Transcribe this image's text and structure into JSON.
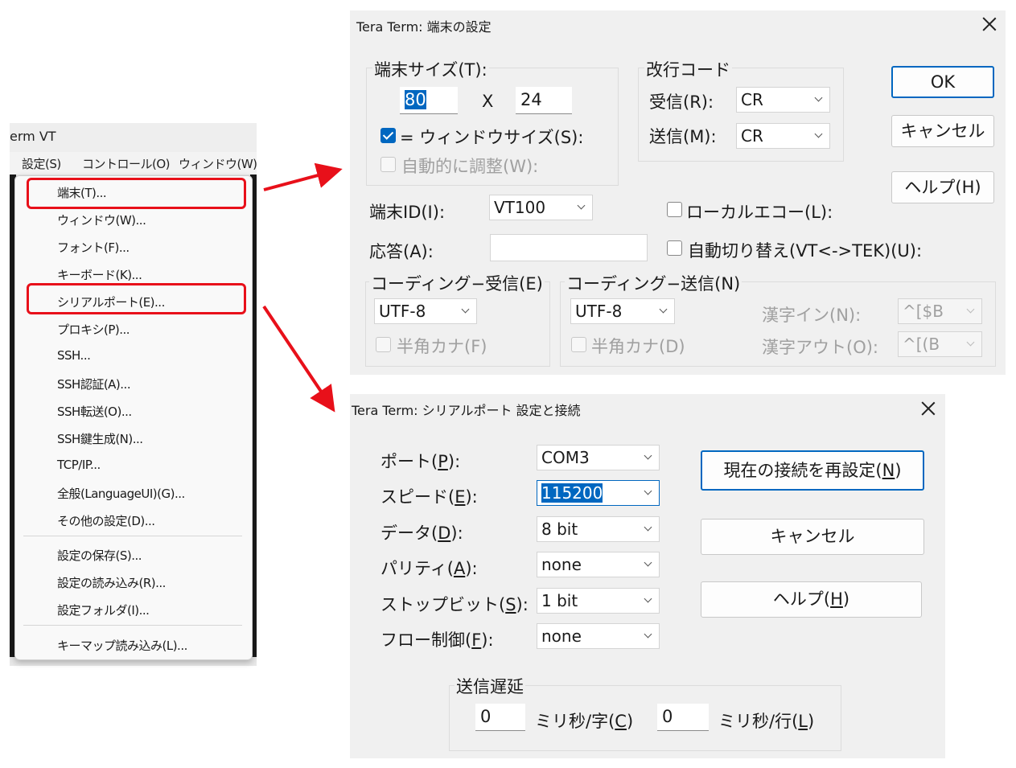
{
  "menu_window": {
    "title": "erm VT",
    "menubar": [
      "設定(S)",
      "コントロール(O)",
      "ウィンドウ(W)"
    ],
    "items": [
      "端末(T)...",
      "ウィンドウ(W)...",
      "フォント(F)...",
      "キーボード(K)...",
      "シリアルポート(E)...",
      "プロキシ(P)...",
      "SSH...",
      "SSH認証(A)...",
      "SSH転送(O)...",
      "SSH鍵生成(N)...",
      "TCP/IP...",
      "全般(LanguageUI)(G)...",
      "その他の設定(D)...",
      "設定の保存(S)...",
      "設定の読み込み(R)...",
      "設定フォルダ(I)...",
      "キーマップ読み込み(L)..."
    ]
  },
  "terminal_dialog": {
    "title": "Tera Term: 端末の設定",
    "size_group": "端末サイズ(T):",
    "cols": "80",
    "x_label": "X",
    "rows": "24",
    "eq_window": "= ウィンドウサイズ(S):",
    "auto_resize": "自動的に調整(W):",
    "newline_group": "改行コード",
    "recv_label": "受信(R):",
    "recv_value": "CR",
    "send_label": "送信(M):",
    "send_value": "CR",
    "ok": "OK",
    "cancel": "キャンセル",
    "help": "ヘルプ(H)",
    "term_id_label": "端末ID(I):",
    "term_id_value": "VT100",
    "local_echo": "ローカルエコー(L):",
    "answer_label": "応答(A):",
    "answer_value": "",
    "auto_switch": "自動切り替え(VT<->TEK)(U):",
    "coding_recv_group": "コーディング−受信(E)",
    "coding_recv_value": "UTF-8",
    "hankaku_recv": "半角カナ(F)",
    "coding_send_group": "コーディング−送信(N)",
    "coding_send_value": "UTF-8",
    "hankaku_send": "半角カナ(D)",
    "kanji_in_label": "漢字イン(N):",
    "kanji_in_value": "^[$B",
    "kanji_out_label": "漢字アウト(O):",
    "kanji_out_value": "^[(B"
  },
  "serial_dialog": {
    "title": "Tera Term: シリアルポート 設定と接続",
    "port": {
      "pre": "ポート(",
      "key": "P",
      "post": "):",
      "value": "COM3"
    },
    "speed": {
      "pre": "スピード(",
      "key": "E",
      "post": "):",
      "value": "115200"
    },
    "data": {
      "pre": "データ(",
      "key": "D",
      "post": "):",
      "value": "8 bit"
    },
    "parity": {
      "pre": "パリティ(",
      "key": "A",
      "post": "):",
      "value": "none"
    },
    "stopbit": {
      "pre": "ストップビット(",
      "key": "S",
      "post": "):",
      "value": "1 bit"
    },
    "flow": {
      "pre": "フロー制御(",
      "key": "F",
      "post": "):",
      "value": "none"
    },
    "reconnect": {
      "pre": "現在の接続を再設定(",
      "key": "N",
      "post": ")"
    },
    "cancel": "キャンセル",
    "help": {
      "pre": "ヘルプ(",
      "key": "H",
      "post": ")"
    },
    "delay_group": "送信遅延",
    "char_delay_value": "0",
    "char_delay": {
      "pre": "ミリ秒/字(",
      "key": "C",
      "post": ")"
    },
    "line_delay_value": "0",
    "line_delay": {
      "pre": "ミリ秒/行(",
      "key": "L",
      "post": ")"
    }
  },
  "colors": {
    "highlight": "#e8101a",
    "accent": "#0067c0"
  }
}
